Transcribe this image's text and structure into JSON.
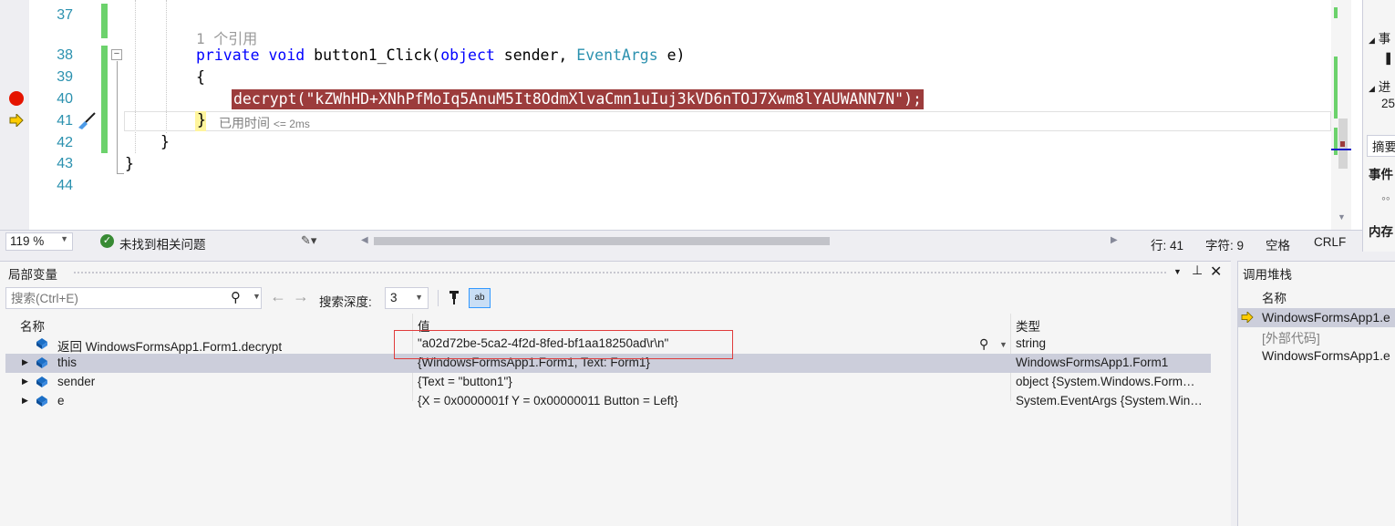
{
  "editor": {
    "line_numbers": [
      "37",
      "38",
      "39",
      "40",
      "41",
      "42",
      "43",
      "44"
    ],
    "codelens": "1 个引用",
    "kw_private": "private",
    "kw_void": "void",
    "method_name": "button1_Click(",
    "kw_object": "object",
    "param_sender": " sender, ",
    "type_eventargs": "EventArgs",
    "param_e": " e)",
    "open_brace": "{",
    "breakpoint_statement": "decrypt(\"kZWhHD+XNhPfMoIq5AnuM5It8OdmXlvaCmn1uIuj3kVD6nTOJ7Xwm8lYAUWANN7N\");",
    "close_brace_method": "}",
    "elapsed_label": "已用时间",
    "elapsed_value": "<= 2ms",
    "close_brace_class": "}",
    "close_brace_ns": "}",
    "colors": {
      "breakpoint_bg": "#9c3c3c",
      "keyword": "#0000ff",
      "type": "#2b91af"
    }
  },
  "status": {
    "zoom": "119 %",
    "issues": "未找到相关问题",
    "line": "行: 41",
    "char": "字符: 9",
    "spacing": "空格",
    "eol": "CRLF"
  },
  "diagnostics": {
    "events_label": "事",
    "progress_label": "进",
    "progress_value": "25",
    "summary_tab": "摘要",
    "events_tab": "事件",
    "memory_label": "内存"
  },
  "locals": {
    "title": "局部变量",
    "search_placeholder": "搜索(Ctrl+E)",
    "depth_label": "搜索深度:",
    "depth_value": "3",
    "columns": {
      "name": "名称",
      "value": "值",
      "type": "类型"
    },
    "rows": [
      {
        "name": "返回 WindowsFormsApp1.Form1.decrypt",
        "value": "\"a02d72be-5ca2-4f2d-8fed-bf1aa18250ad\\r\\n\"",
        "type": "string",
        "expandable": false
      },
      {
        "name": "this",
        "value": "{WindowsFormsApp1.Form1, Text: Form1}",
        "type": "WindowsFormsApp1.Form1",
        "expandable": true
      },
      {
        "name": "sender",
        "value": "{Text = \"button1\"}",
        "type": "object {System.Windows.Form…",
        "expandable": true
      },
      {
        "name": "e",
        "value": "{X = 0x0000001f Y = 0x00000011 Button = Left}",
        "type": "System.EventArgs {System.Win…",
        "expandable": true
      }
    ]
  },
  "callstack": {
    "title": "调用堆栈",
    "column_name": "名称",
    "frames": [
      {
        "label": "WindowsFormsApp1.e"
      },
      {
        "label": "[外部代码]"
      },
      {
        "label": "WindowsFormsApp1.e"
      }
    ]
  }
}
